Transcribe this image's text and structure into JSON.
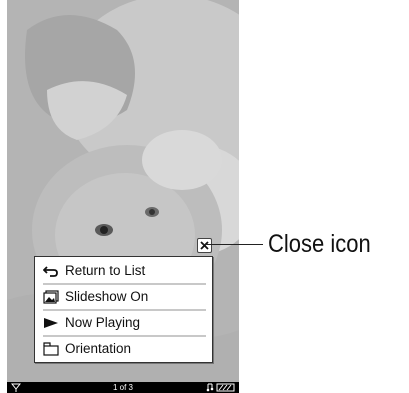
{
  "photo": {
    "subject": "baby-photo"
  },
  "menu": {
    "items": [
      {
        "label": "Return to List",
        "icon": "return-arrow-icon"
      },
      {
        "label": "Slideshow On",
        "icon": "slideshow-icon"
      },
      {
        "label": "Now Playing",
        "icon": "play-icon"
      },
      {
        "label": "Orientation",
        "icon": "orientation-icon"
      }
    ]
  },
  "status": {
    "page": "1 of 3"
  },
  "callout": {
    "label": "Close icon"
  },
  "colors": {
    "background": "#ffffff",
    "screen": "#000000",
    "menu": "#ffffff"
  }
}
